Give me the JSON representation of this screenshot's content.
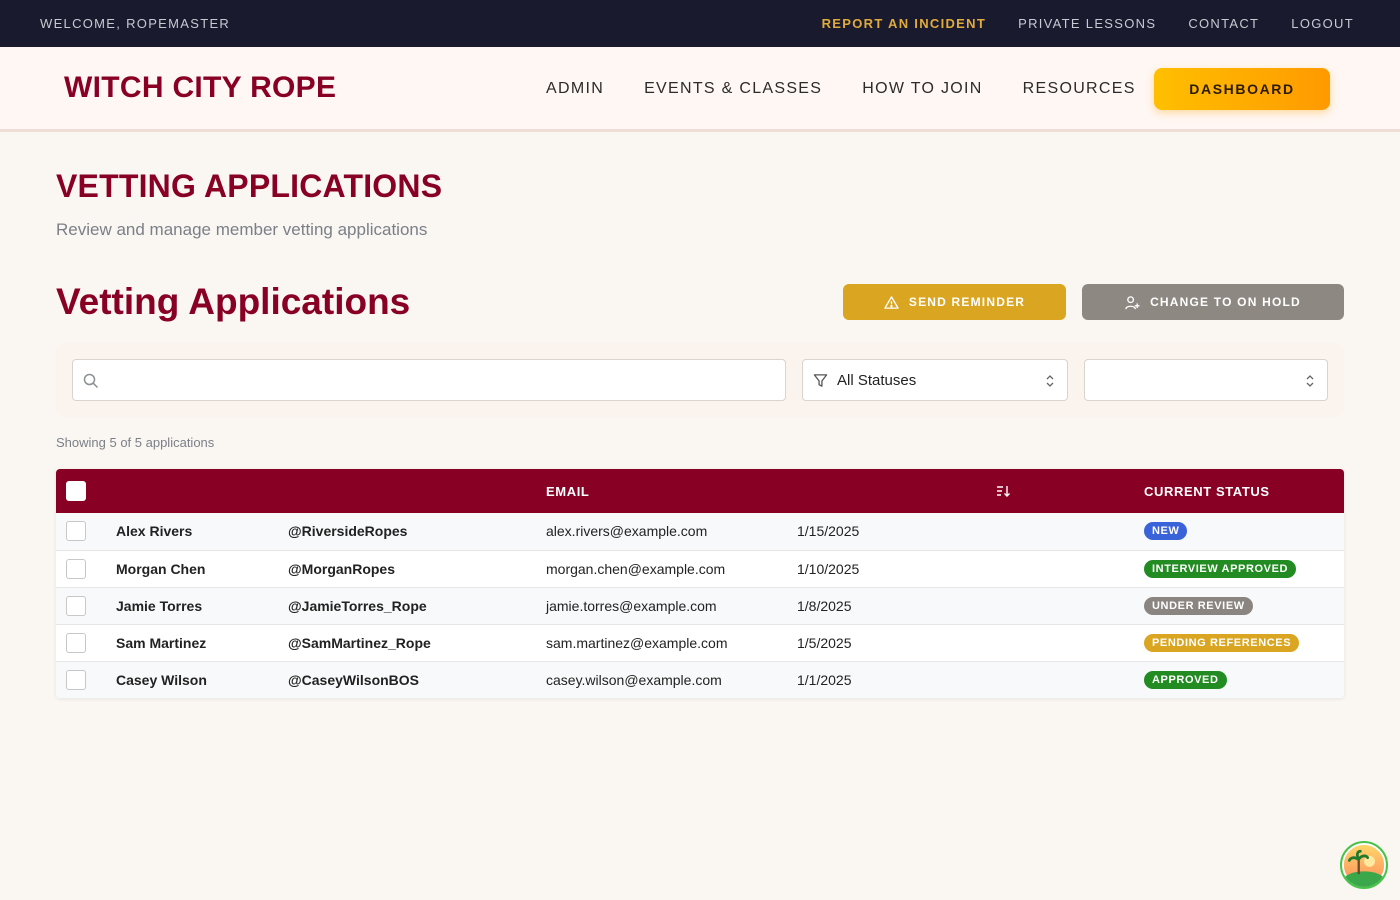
{
  "utility_bar": {
    "welcome": "WELCOME, ROPEMASTER",
    "links": [
      "REPORT AN INCIDENT",
      "PRIVATE LESSONS",
      "CONTACT",
      "LOGOUT"
    ]
  },
  "nav": {
    "brand": "WITCH CITY ROPE",
    "items": [
      "ADMIN",
      "EVENTS & CLASSES",
      "HOW TO JOIN",
      "RESOURCES"
    ],
    "dashboard": "DASHBOARD"
  },
  "page": {
    "title": "VETTING APPLICATIONS",
    "subtitle": "Review and manage member vetting applications"
  },
  "section": {
    "title": "Vetting Applications",
    "send_reminder": "SEND REMINDER",
    "change_on_hold": "CHANGE TO ON HOLD"
  },
  "filters": {
    "search_value": "",
    "status_selected": "All Statuses",
    "sort_selected": ""
  },
  "showing": "Showing 5 of 5 applications",
  "table": {
    "headers": {
      "email": "EMAIL",
      "status": "CURRENT STATUS"
    },
    "rows": [
      {
        "name": "Alex Rivers",
        "handle": "@RiversideRopes",
        "email": "alex.rivers@example.com",
        "date": "1/15/2025",
        "status": "NEW",
        "status_color": "#3b63d9"
      },
      {
        "name": "Morgan Chen",
        "handle": "@MorganRopes",
        "email": "morgan.chen@example.com",
        "date": "1/10/2025",
        "status": "INTERVIEW APPROVED",
        "status_color": "#228b22"
      },
      {
        "name": "Jamie Torres",
        "handle": "@JamieTorres_Rope",
        "email": "jamie.torres@example.com",
        "date": "1/8/2025",
        "status": "UNDER REVIEW",
        "status_color": "#8a8580"
      },
      {
        "name": "Sam Martinez",
        "handle": "@SamMartinez_Rope",
        "email": "sam.martinez@example.com",
        "date": "1/5/2025",
        "status": "PENDING REFERENCES",
        "status_color": "#daa520"
      },
      {
        "name": "Casey Wilson",
        "handle": "@CaseyWilsonBOS",
        "email": "casey.wilson@example.com",
        "date": "1/1/2025",
        "status": "APPROVED",
        "status_color": "#228b22"
      }
    ]
  },
  "colors": {
    "brand": "#880124",
    "utility_bg": "#1a1a2e",
    "accent_gold": "#daa520",
    "dashboard_gradient": [
      "#ffbf00",
      "#ff9a00"
    ]
  },
  "icons": [
    "search-icon",
    "filter-icon",
    "warning-icon",
    "user-plus-icon",
    "sort-icon",
    "chevron-updown-icon",
    "assistant-avatar-icon"
  ]
}
